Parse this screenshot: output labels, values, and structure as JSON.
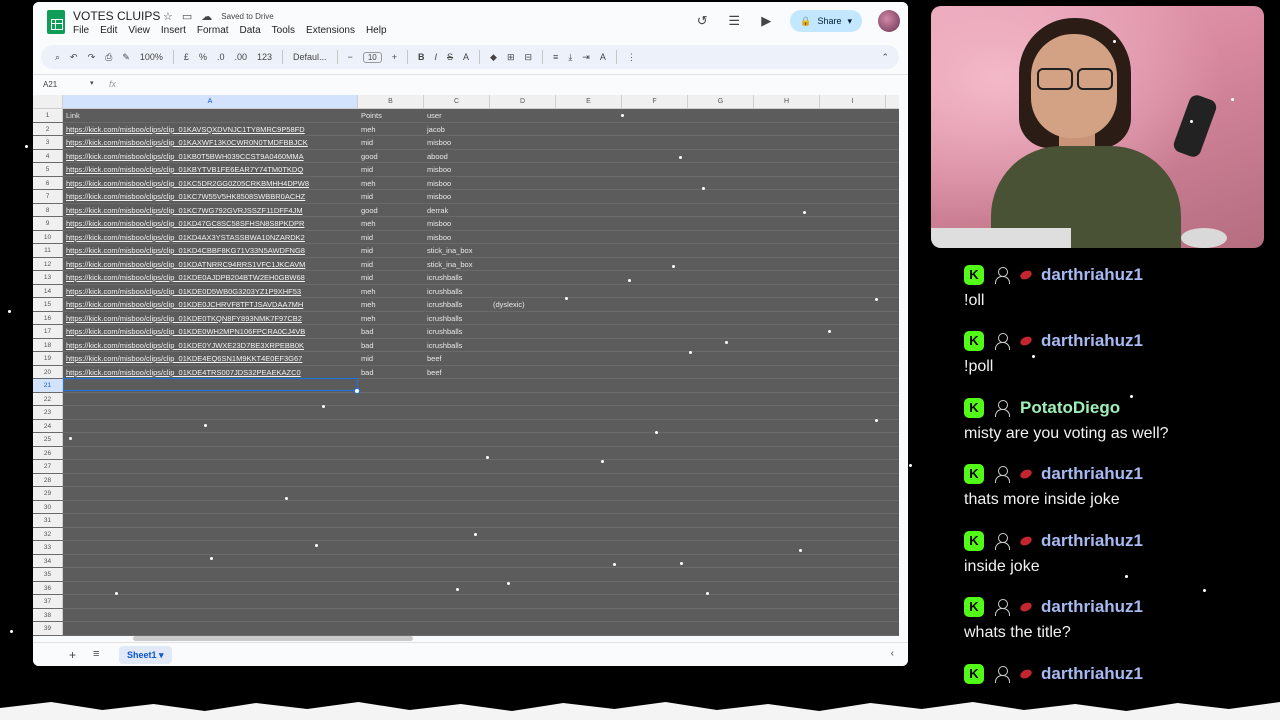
{
  "sheet": {
    "title": "VOTES CLUIPS",
    "saved_status": "Saved to Drive",
    "menu": [
      "File",
      "Edit",
      "View",
      "Insert",
      "Format",
      "Data",
      "Tools",
      "Extensions",
      "Help"
    ],
    "share_label": "Share",
    "toolbar": {
      "zoom": "100%",
      "currency": "£",
      "percent": "%",
      "dec_less": ".0",
      "dec_more": ".00",
      "number_format": "123",
      "font": "Defaul...",
      "font_size": "10"
    },
    "name_box": "A21",
    "fx_label": "fx",
    "columns": [
      "A",
      "B",
      "C",
      "D",
      "E",
      "F",
      "G",
      "H",
      "I"
    ],
    "header_row": {
      "a": "Link",
      "b": "Points",
      "c": "user"
    },
    "rows": [
      {
        "n": "2",
        "a": "https://kick.com/misboo/clips/clip_01KAVSQXDVNJC1TY8MRC9P58FD",
        "b": "meh",
        "c": "jacob",
        "d": ""
      },
      {
        "n": "3",
        "a": "https://kick.com/misboo/clips/clip_01KAXWF13K0CWR0N0TMDFBBJCK",
        "b": "mid",
        "c": "misboo",
        "d": ""
      },
      {
        "n": "4",
        "a": "https://kick.com/misboo/clips/clip_01KB0T5BWH039CCST9A0460MMA",
        "b": "good",
        "c": "abood",
        "d": ""
      },
      {
        "n": "5",
        "a": "https://kick.com/misboo/clips/clip_01KBYTVB1FE6EAR7Y74TM0TKDQ",
        "b": "mid",
        "c": "misboo",
        "d": ""
      },
      {
        "n": "6",
        "a": "https://kick.com/misboo/clips/clip_01KC5DR2GG0Z05CRKBMHH4DPW8",
        "b": "meh",
        "c": "misboo",
        "d": ""
      },
      {
        "n": "7",
        "a": "https://kick.com/misboo/clips/clip_01KC7W55V5HK8508SWBBR0ACHZ",
        "b": "mid",
        "c": "misboo",
        "d": ""
      },
      {
        "n": "8",
        "a": "https://kick.com/misboo/clips/clip_01KC7WG792GVRJSSZF11DFF4JM",
        "b": "good",
        "c": "derrak",
        "d": ""
      },
      {
        "n": "9",
        "a": "https://kick.com/misboo/clips/clip_01KD47GC8SC58SFHSN8S8PKDPR",
        "b": "meh",
        "c": "misboo",
        "d": ""
      },
      {
        "n": "10",
        "a": "https://kick.com/misboo/clips/clip_01KD4AX3YSTASSBWA10NZARDK2",
        "b": "mid",
        "c": "misboo",
        "d": ""
      },
      {
        "n": "11",
        "a": "https://kick.com/misboo/clips/clip_01KD4CBBF8KG71V33N5AWDFNG8",
        "b": "mid",
        "c": "stick_ina_box",
        "d": ""
      },
      {
        "n": "12",
        "a": "https://kick.com/misboo/clips/clip_01KDATNRRC94RRS1VFC1JKCAVM",
        "b": "mid",
        "c": "stick_ina_box",
        "d": ""
      },
      {
        "n": "13",
        "a": "https://kick.com/misboo/clips/clip_01KDE0AJDPB204BTW2EH0GBW68",
        "b": "mid",
        "c": "icrushballs",
        "d": ""
      },
      {
        "n": "14",
        "a": "https://kick.com/misboo/clips/clip_01KDE0D5WB0G3203YZ1P9XHF53",
        "b": "meh",
        "c": "icrushballs",
        "d": ""
      },
      {
        "n": "15",
        "a": "https://kick.com/misboo/clips/clip_01KDE0JCHRVF8TFTJSAVDAA7MH",
        "b": "meh",
        "c": "icrushballs",
        "d": "(dyslexic)"
      },
      {
        "n": "16",
        "a": "https://kick.com/misboo/clips/clip_01KDE0TKQN8FY893NMK7F97CB2",
        "b": "meh",
        "c": "icrushballs",
        "d": ""
      },
      {
        "n": "17",
        "a": "https://kick.com/misboo/clips/clip_01KDE0WH2MPN106FPCRA0CJ4VB",
        "b": "bad",
        "c": "icrushballs",
        "d": ""
      },
      {
        "n": "18",
        "a": "https://kick.com/misboo/clips/clip_01KDE0YJWXE23D7BE3XRPEBB0K",
        "b": "bad",
        "c": "icrushballs",
        "d": ""
      },
      {
        "n": "19",
        "a": "https://kick.com/misboo/clips/clip_01KDE4EQ6SN1M9KKT4E0EF3G67",
        "b": "mid",
        "c": "beef",
        "d": ""
      },
      {
        "n": "20",
        "a": "https://kick.com/misboo/clips/clip_01KDE4TRS007JDS32PEAEKAZC0",
        "b": "bad",
        "c": "beef",
        "d": ""
      }
    ],
    "empty_rows": [
      "21",
      "22",
      "23",
      "24",
      "25",
      "26",
      "27",
      "28",
      "29",
      "30",
      "31",
      "32",
      "33",
      "34",
      "35",
      "36",
      "37",
      "38",
      "39"
    ],
    "sheet_tab": "Sheet1"
  },
  "chat": {
    "colors": {
      "kick_green": "#53fc18",
      "blue_name": "#a7b9f1",
      "green_name": "#9ff0b8"
    },
    "messages": [
      {
        "user": "darthriahuz1",
        "text": "!oll",
        "sub": true,
        "color": "#a7b9f1"
      },
      {
        "user": "darthriahuz1",
        "text": "!poll",
        "sub": true,
        "color": "#a7b9f1"
      },
      {
        "user": "PotatoDiego",
        "text": "misty are you voting as well?",
        "sub": false,
        "color": "#9ff0b8"
      },
      {
        "user": "darthriahuz1",
        "text": "thats more inside joke",
        "sub": true,
        "color": "#a7b9f1"
      },
      {
        "user": "darthriahuz1",
        "text": "inside joke",
        "sub": true,
        "color": "#a7b9f1"
      },
      {
        "user": "darthriahuz1",
        "text": "whats the title?",
        "sub": true,
        "color": "#a7b9f1"
      },
      {
        "user": "darthriahuz1",
        "text": "",
        "sub": true,
        "color": "#a7b9f1"
      }
    ]
  }
}
